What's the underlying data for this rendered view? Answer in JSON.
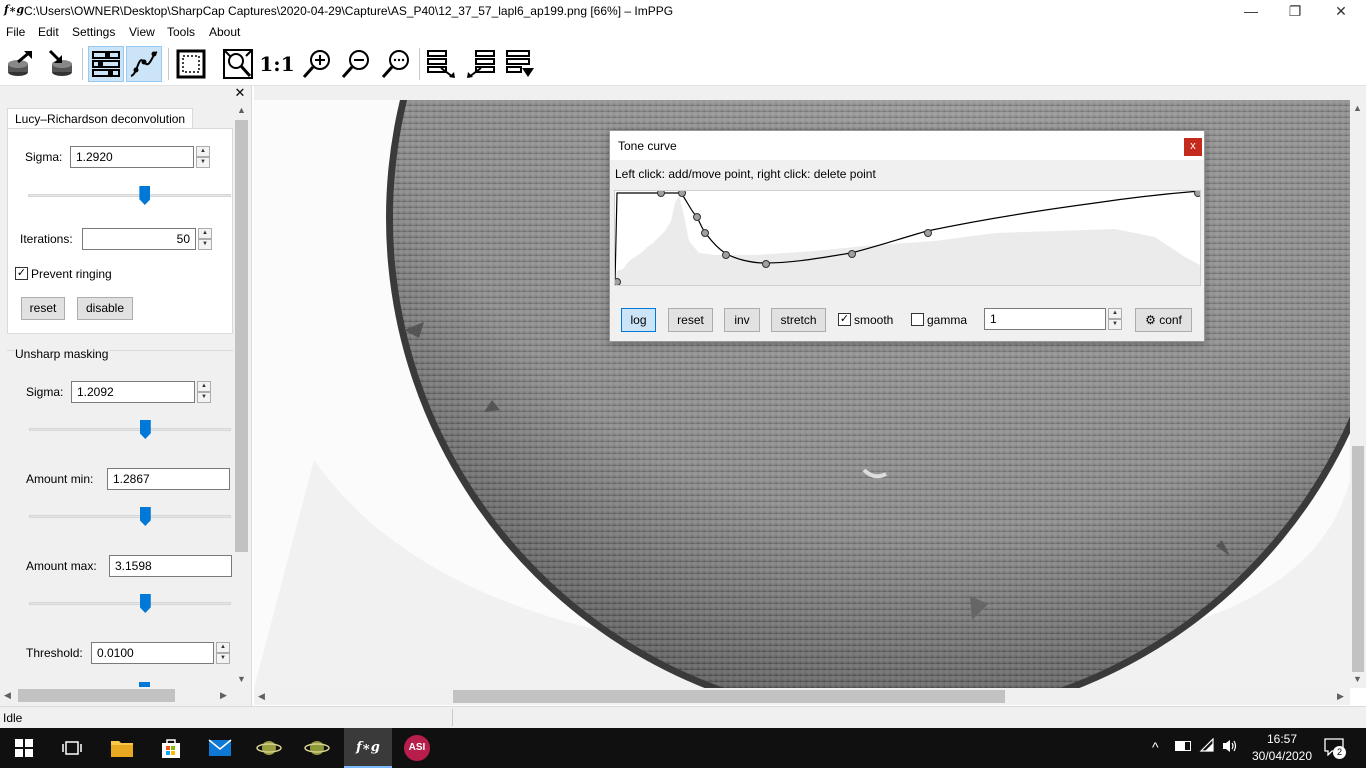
{
  "window": {
    "logo": "f∗g",
    "title": "C:\\Users\\OWNER\\Desktop\\SharpCap Captures\\2020-04-29\\Capture\\AS_P40\\12_37_57_lapl6_ap199.png [66%] – ImPPG",
    "minimize": "—",
    "restore": "❐",
    "close": "✕"
  },
  "menu": [
    "File",
    "Edit",
    "Settings",
    "View",
    "Tools",
    "About"
  ],
  "toolbar": {
    "icons": [
      "open-file-icon",
      "save-file-icon",
      "toggle-processing-panel-icon",
      "toggle-tone-curve-icon",
      "fit-selection-icon",
      "zoom-fit-icon",
      "zoom-in-icon",
      "zoom-out-icon",
      "zoom-custom-icon",
      "batch-processing-icon",
      "alignment-icon",
      "settings-merge-icon"
    ],
    "zoom_1to1": "1:1",
    "active": [
      "toggle-processing-panel-icon",
      "toggle-tone-curve-icon"
    ]
  },
  "panel": {
    "close": "✕",
    "lucy": {
      "title": "Lucy–Richardson deconvolution",
      "sigma_label": "Sigma:",
      "sigma_value": "1.2920",
      "sigma_slider": 0.58,
      "iterations_label": "Iterations:",
      "iterations_value": "50",
      "prevent_ringing_label": "Prevent ringing",
      "prevent_ringing": true,
      "reset": "reset",
      "disable": "disable"
    },
    "usm": {
      "title": "Unsharp masking",
      "sigma_label": "Sigma:",
      "sigma_value": "1.2092",
      "sigma_slider": 0.58,
      "amount_min_label": "Amount min:",
      "amount_min_value": "1.2867",
      "amount_min_slider": 0.58,
      "amount_max_label": "Amount max:",
      "amount_max_value": "3.1598",
      "amount_max_slider": 0.58,
      "threshold_label": "Threshold:",
      "threshold_value": "0.0100"
    }
  },
  "tone_curve": {
    "title": "Tone curve",
    "close": "x",
    "hint": "Left click: add/move point, right click: delete point",
    "buttons": {
      "log": "log",
      "reset": "reset",
      "inv": "inv",
      "stretch": "stretch",
      "smooth": "smooth",
      "gamma": "gamma",
      "gamma_value": "1",
      "conf": "⚙ conf"
    },
    "smooth_checked": true,
    "gamma_checked": false,
    "log_active": true
  },
  "status": {
    "text": "Idle"
  },
  "taskbar": {
    "apps": [
      "start-icon",
      "task-view-icon",
      "file-explorer-icon",
      "store-icon",
      "mail-icon",
      "saturn-app-icon",
      "saturn-app-2-icon",
      "imppg-icon",
      "asi-studio-icon"
    ],
    "active_app": "imppg-icon",
    "imppg_label": "f∗g",
    "asi_label": "ASI",
    "time": "16:57",
    "date": "30/04/2020",
    "notifications": "2",
    "tray_chevron": "^"
  }
}
